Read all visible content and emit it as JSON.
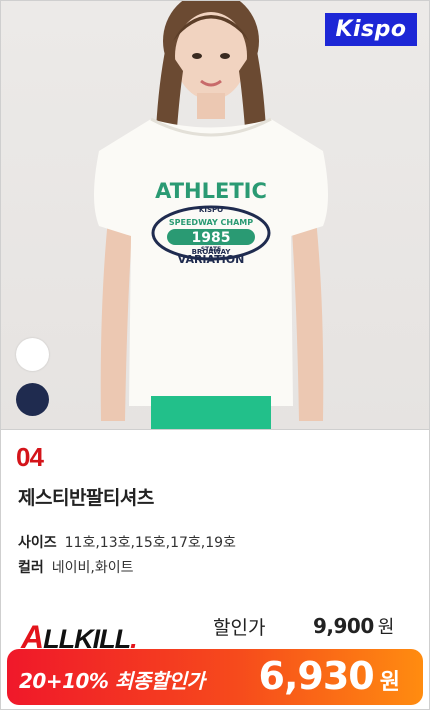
{
  "product": {
    "number": "04",
    "brand": "Kispo",
    "title": "제스티반팔티셔츠",
    "shirt_print": {
      "line1": "ATHLETIC",
      "line2": "KISPO",
      "line3": "SPEEDWAY CHAMP",
      "line4": "STATE",
      "line5": "1985",
      "line6": "BROAWAY",
      "line7": "VARIATION"
    },
    "color_swatches": [
      {
        "name": "white",
        "hex": "#ffffff"
      },
      {
        "name": "navy",
        "hex": "#1f2b4f"
      }
    ]
  },
  "specs": {
    "size_label": "사이즈",
    "size_value": "11호,13호,15호,17호,19호",
    "color_label": "컬러",
    "color_value": "네이비,화이트"
  },
  "pricing": {
    "badge": {
      "first": "A",
      "rest": "LLKILL",
      "dot": "."
    },
    "price_label": "할인가",
    "price_value": "9,900",
    "price_unit": "원",
    "promo_text": "20+10% 최종할인가",
    "final_price": "6,930",
    "final_unit": "원"
  },
  "colors": {
    "accent_red": "#d4141a",
    "brand_blue": "#1d27d6",
    "promo_start": "#f0182a",
    "promo_end": "#ff8c10"
  }
}
